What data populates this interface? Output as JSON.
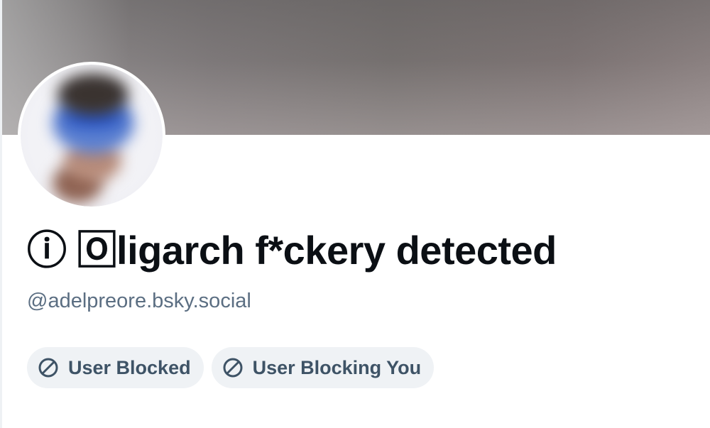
{
  "profile": {
    "display_name": "ⓘ 🄾ligarch f*ckery detected",
    "handle": "@adelpreore.bsky.social",
    "avatar_icon": "user-avatar-blurred",
    "banner_colors": [
      "#8e8b8c",
      "#75706f",
      "#8a8080"
    ]
  },
  "badges": [
    {
      "label": "User Blocked",
      "icon": "block-icon"
    },
    {
      "label": "User Blocking You",
      "icon": "block-icon"
    }
  ],
  "colors": {
    "name_text": "#0b0f14",
    "handle_text": "#5b6e82",
    "badge_bg": "#eff2f5",
    "badge_text": "#3e5366"
  }
}
